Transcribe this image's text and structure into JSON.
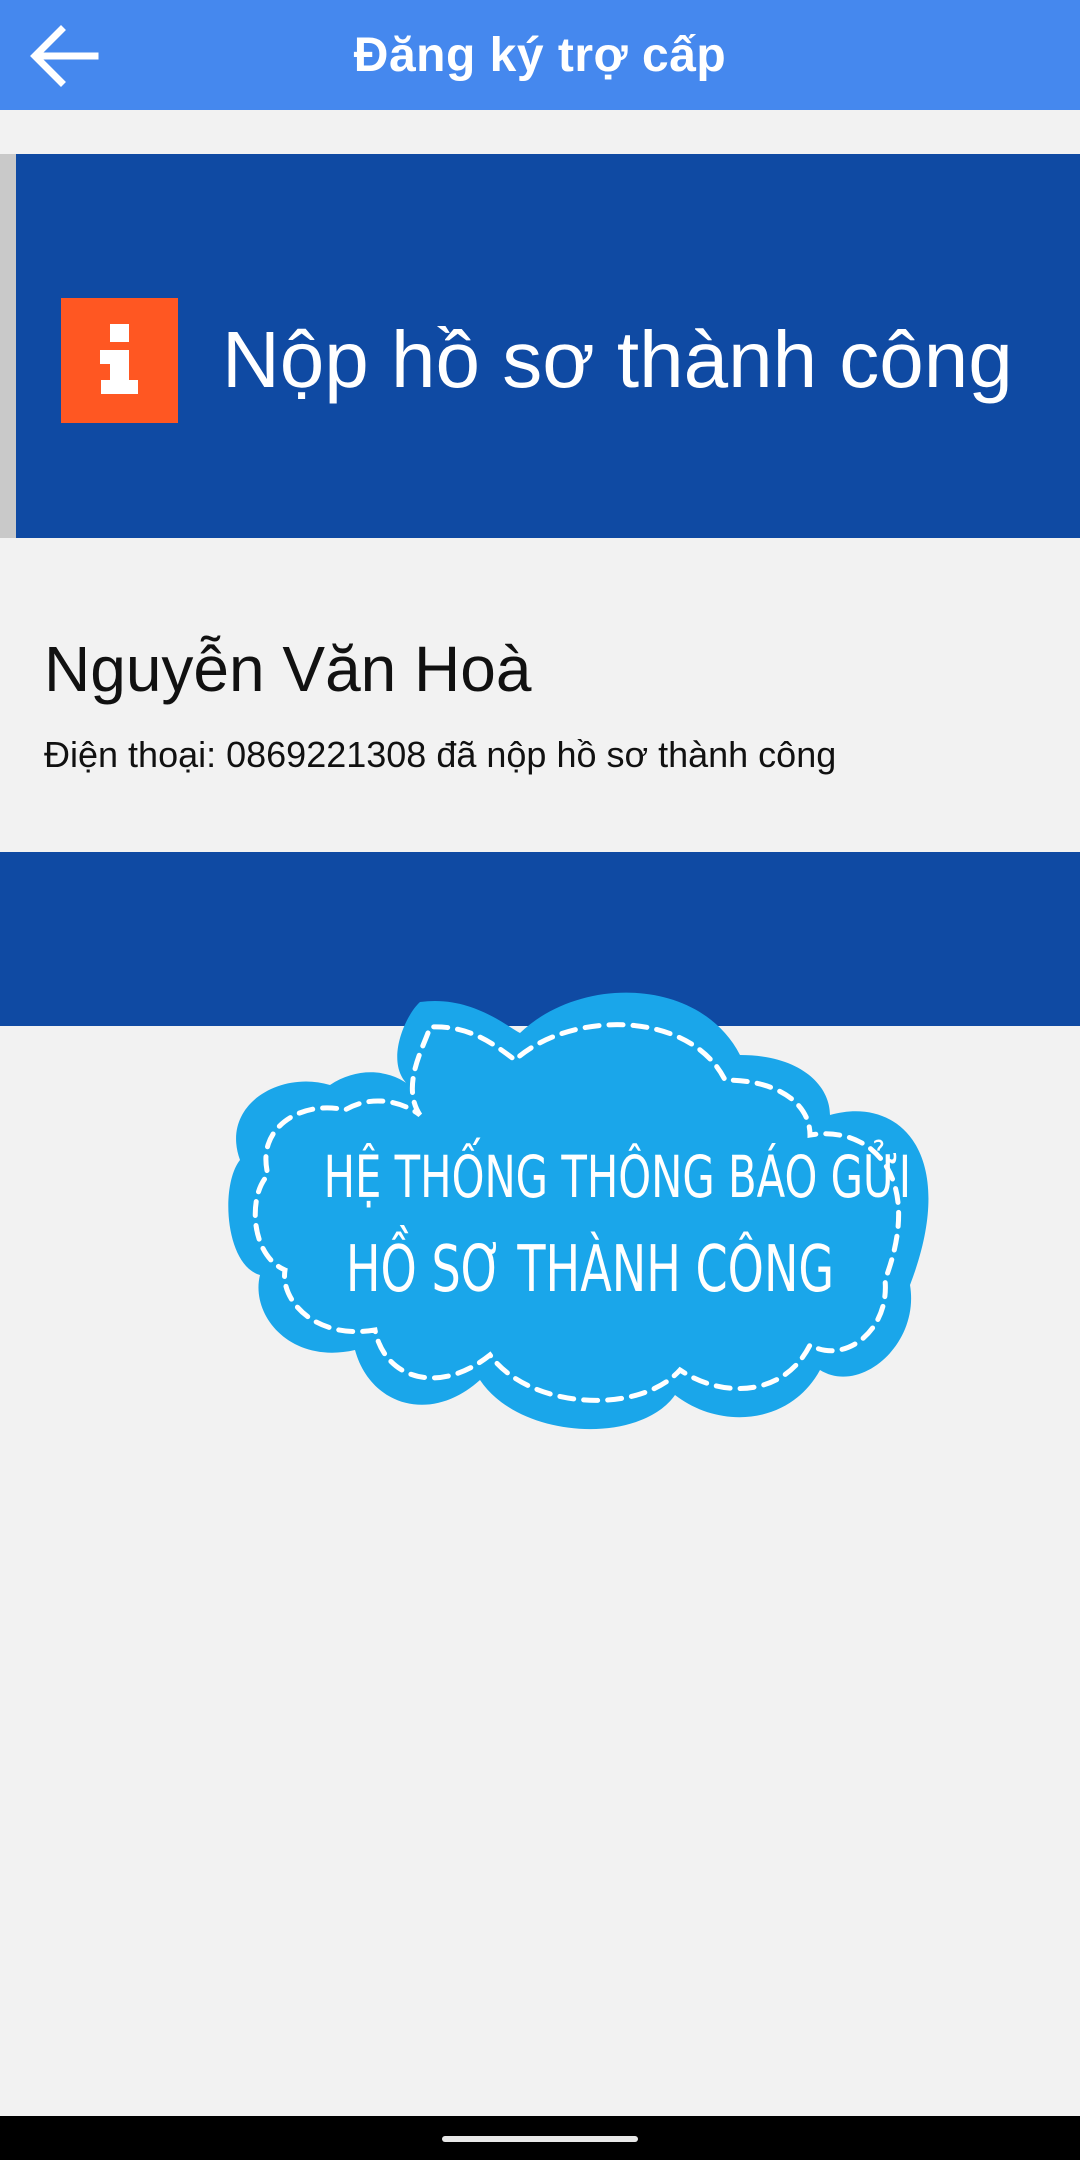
{
  "appbar": {
    "title": "Đăng ký trợ cấp",
    "back_icon": "arrow-left-icon"
  },
  "banner": {
    "icon": "info-icon",
    "title": "Nộp hồ sơ thành công",
    "icon_color": "#ff5722",
    "background": "#0f4aa3"
  },
  "applicant": {
    "name": "Nguyễn Văn Hoà",
    "phone_line": "Điện thoại: 0869221308 đã nộp hồ sơ thành công"
  },
  "cloud": {
    "line1": "HỆ THỐNG THÔNG BÁO GỬI",
    "line2": "HỒ SƠ THÀNH CÔNG",
    "color": "#1aa6ea"
  },
  "colors": {
    "appbar": "#4588ee",
    "page_background": "#f2f2f2"
  }
}
